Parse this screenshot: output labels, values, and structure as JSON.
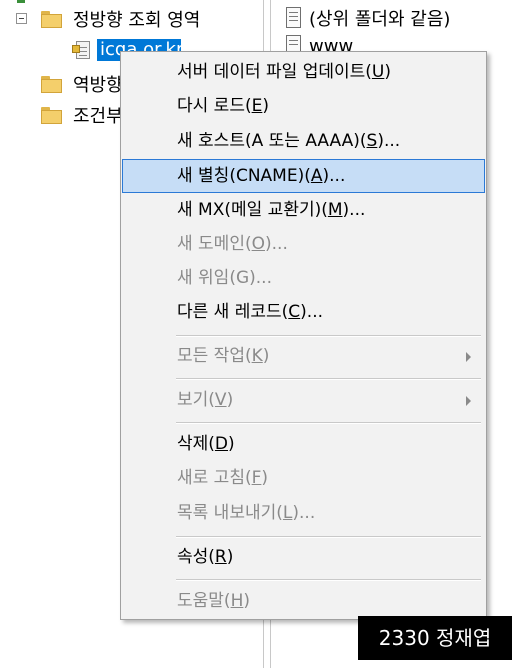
{
  "tree": {
    "forward_zone_label": "정방향 조회 영역",
    "selected_zone_label": "icqa.or.kr",
    "reverse_zone_label_partial": "역방향",
    "conditional_forwarders_label_partial": "조건부"
  },
  "records": {
    "parent_folder_label": "(상위 폴더와 같음)",
    "www_label": "www"
  },
  "context_menu": {
    "items": [
      {
        "pre": "서버 데이터 파일 업데이트(",
        "key": "U",
        "post": ")",
        "disabled": false,
        "submenu": false
      },
      {
        "pre": "다시 로드(",
        "key": "E",
        "post": ")",
        "disabled": false,
        "submenu": false
      },
      {
        "pre": "새 호스트(A 또는 AAAA)(",
        "key": "S",
        "post": ")...",
        "disabled": false,
        "submenu": false
      },
      {
        "pre": "새 별칭(CNAME)(",
        "key": "A",
        "post": ")...",
        "disabled": false,
        "submenu": false,
        "highlighted": true
      },
      {
        "pre": "새 MX(메일 교환기)(",
        "key": "M",
        "post": ")...",
        "disabled": false,
        "submenu": false
      },
      {
        "pre": "새 도메인(",
        "key": "O",
        "post": ")...",
        "disabled": true,
        "submenu": false
      },
      {
        "pre": "새 위임(G)...",
        "key": "",
        "post": "",
        "disabled": true,
        "submenu": false
      },
      {
        "pre": "다른 새 레코드(",
        "key": "C",
        "post": ")...",
        "disabled": false,
        "submenu": false
      },
      {
        "pre": "모든 작업(",
        "key": "K",
        "post": ")",
        "disabled": true,
        "submenu": true
      },
      {
        "pre": "보기(",
        "key": "V",
        "post": ")",
        "disabled": true,
        "submenu": true
      },
      {
        "pre": "삭제(",
        "key": "D",
        "post": ")",
        "disabled": false,
        "submenu": false
      },
      {
        "pre": "새로 고침(",
        "key": "F",
        "post": ")",
        "disabled": true,
        "submenu": false
      },
      {
        "pre": "목록 내보내기(",
        "key": "L",
        "post": ")...",
        "disabled": true,
        "submenu": false
      },
      {
        "pre": "속성(",
        "key": "R",
        "post": ")",
        "disabled": false,
        "submenu": false
      },
      {
        "pre": "도움말(",
        "key": "H",
        "post": ")",
        "disabled": true,
        "submenu": false
      }
    ]
  },
  "caption": {
    "text": "2330 정재엽"
  },
  "colors": {
    "selection_blue": "#0078d7",
    "menu_highlight": "#c6ddf6",
    "menu_highlight_border": "#2b79d6",
    "menu_background": "#f2f2f2",
    "disabled_text": "#8a8a8a",
    "folder_yellow": "#f4cf6b"
  },
  "icons": {
    "expander": "minus-box-icon",
    "folder": "folder-icon",
    "zone_file": "zone-file-icon",
    "record": "document-icon",
    "submenu": "chevron-right-icon"
  }
}
